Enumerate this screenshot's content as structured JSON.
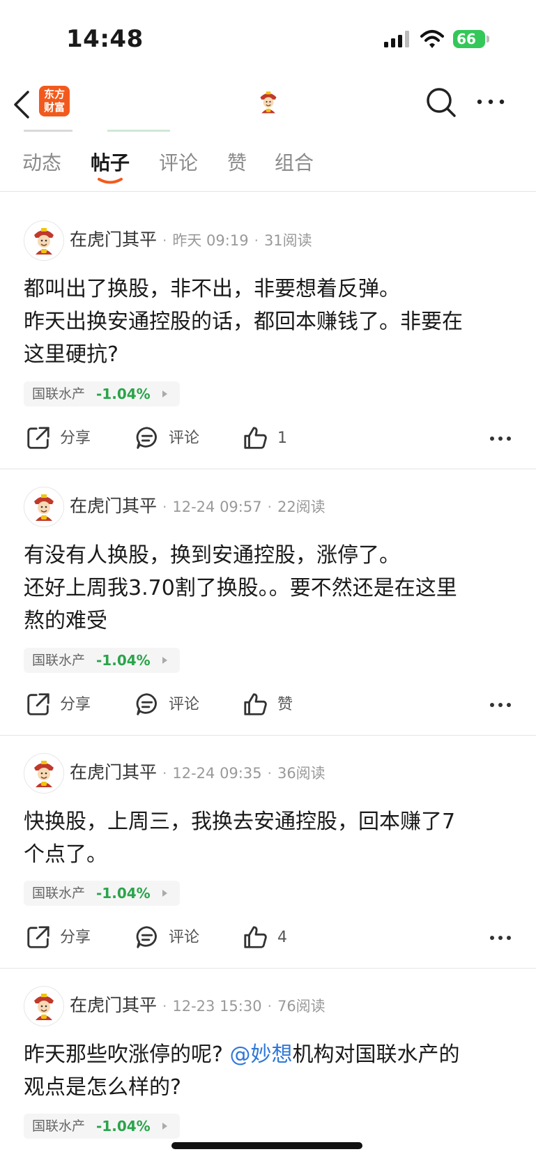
{
  "status": {
    "time": "14:48",
    "battery": "66"
  },
  "header": {
    "logo_text": "东方财富"
  },
  "tabs": [
    {
      "label": "动态",
      "active": false
    },
    {
      "label": "帖子",
      "active": true
    },
    {
      "label": "评论",
      "active": false
    },
    {
      "label": "赞",
      "active": false
    },
    {
      "label": "组合",
      "active": false
    }
  ],
  "posts": [
    {
      "author": "在虎门其平",
      "time": "昨天 09:19",
      "reads": "31阅读",
      "line1": "都叫出了换股，非不出，非要想着反弹。",
      "line2": "昨天出换安通控股的话，都回本赚钱了。非要在",
      "line3": "这里硬抗?",
      "stock_name": "国联水产",
      "stock_change": "-1.04%",
      "share_label": "分享",
      "comment_label": "评论",
      "like_label": "1"
    },
    {
      "author": "在虎门其平",
      "time": "12-24 09:57",
      "reads": "22阅读",
      "line1": "有没有人换股，换到安通控股，涨停了。",
      "line2": "还好上周我3.70割了换股。。要不然还是在这里",
      "line3": "熬的难受",
      "stock_name": "国联水产",
      "stock_change": "-1.04%",
      "share_label": "分享",
      "comment_label": "评论",
      "like_label": "赞"
    },
    {
      "author": "在虎门其平",
      "time": "12-24 09:35",
      "reads": "36阅读",
      "line1": "快换股，上周三，我换去安通控股，回本赚了7",
      "line2": "个点了。",
      "stock_name": "国联水产",
      "stock_change": "-1.04%",
      "share_label": "分享",
      "comment_label": "评论",
      "like_label": "4"
    },
    {
      "author": "在虎门其平",
      "time": "12-23 15:30",
      "reads": "76阅读",
      "line1_pre": "昨天那些吹涨停的呢? ",
      "line1_mention": "@妙想",
      "line1_post": "机构对国联水产的",
      "line2": "观点是怎么样的?",
      "stock_name": "国联水产",
      "stock_change": "-1.04%"
    }
  ],
  "colors": {
    "accent": "#f25a1d",
    "down": "#2aa44a",
    "mention": "#2f77d8"
  }
}
